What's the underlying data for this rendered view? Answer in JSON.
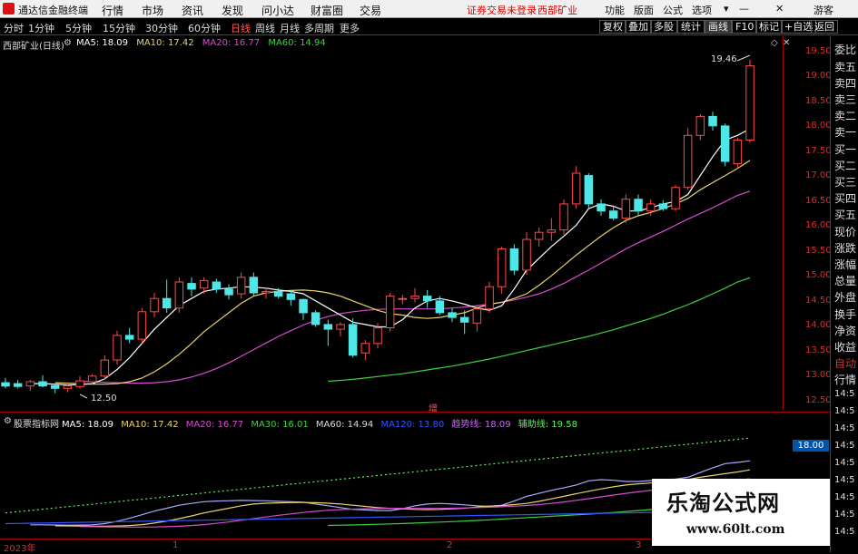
{
  "app": {
    "title": "通达信金融终端"
  },
  "menu": [
    "行情",
    "市场",
    "资讯",
    "发现",
    "问小达",
    "财富圈",
    "交易"
  ],
  "status": {
    "login": "证券交易未登录",
    "stock": "西部矿业"
  },
  "right_menu": [
    "功能",
    "版面",
    "公式",
    "选项",
    "游客"
  ],
  "periods": [
    "分时",
    "1分钟",
    "5分钟",
    "15分钟",
    "30分钟",
    "60分钟",
    "日线",
    "周线",
    "月线",
    "多周期",
    "更多"
  ],
  "active_period": "日线",
  "tools": [
    "复权",
    "叠加",
    "多股",
    "统计",
    "画线",
    "F10",
    "标记",
    "+自选",
    "返回"
  ],
  "main": {
    "stock_label": "西部矿业(日线)",
    "ma": [
      {
        "label": "MA5: 18.09",
        "color": "#ffffff"
      },
      {
        "label": "MA10: 17.42",
        "color": "#e8d36a"
      },
      {
        "label": "MA20: 16.77",
        "color": "#d94cd0"
      },
      {
        "label": "MA60: 14.94",
        "color": "#3fcf3f"
      }
    ],
    "high_label": "19.46",
    "low_label": "12.50",
    "marker": "增"
  },
  "price_axis": [
    "19.50",
    "19.00",
    "18.50",
    "18.00",
    "17.50",
    "17.00",
    "16.50",
    "16.00",
    "15.50",
    "15.00",
    "14.50",
    "14.00",
    "13.50",
    "13.00",
    "12.50"
  ],
  "right_panel": [
    "委比",
    "卖五",
    "卖四",
    "卖三",
    "卖二",
    "卖一",
    "买一",
    "买二",
    "买三",
    "买四",
    "买五",
    "现价",
    "涨跌",
    "涨幅",
    "总量",
    "外盘",
    "换手",
    "净资",
    "收益",
    "自动",
    "行情",
    "14:5",
    "14:5",
    "14:5",
    "14:5",
    "14:5",
    "14:5",
    "14:5",
    "14:5",
    "14:5"
  ],
  "sub": {
    "name": "股票指标网",
    "legend": [
      {
        "label": "MA5: 18.09",
        "color": "#ffffff"
      },
      {
        "label": "MA10: 17.42",
        "color": "#e8d36a"
      },
      {
        "label": "MA20: 16.77",
        "color": "#d94cd0"
      },
      {
        "label": "MA30: 16.01",
        "color": "#3fcf3f"
      },
      {
        "label": "MA60: 14.94",
        "color": "#dddddd"
      },
      {
        "label": "MA120: 13.80",
        "color": "#3355ff"
      },
      {
        "label": "趋势线: 18.09",
        "color": "#cc66ff"
      },
      {
        "label": "辅助线: 19.58",
        "color": "#5ff05f"
      }
    ],
    "badge": "18.00"
  },
  "x_axis": [
    "2023年",
    "1",
    "2",
    "3"
  ],
  "watermark": {
    "line1": "乐淘公式网",
    "line2": "www.60lt.com"
  },
  "chart_data": {
    "type": "candlestick",
    "y_range": [
      12.3,
      19.7
    ],
    "candles": [
      [
        12.72,
        12.82,
        12.6,
        12.65
      ],
      [
        12.7,
        12.78,
        12.6,
        12.64
      ],
      [
        12.65,
        12.78,
        12.55,
        12.74
      ],
      [
        12.74,
        12.88,
        12.62,
        12.65
      ],
      [
        12.66,
        12.7,
        12.5,
        12.6
      ],
      [
        12.6,
        12.68,
        12.52,
        12.65
      ],
      [
        12.64,
        12.86,
        12.6,
        12.76
      ],
      [
        12.74,
        12.9,
        12.68,
        12.86
      ],
      [
        12.86,
        13.3,
        12.8,
        13.2
      ],
      [
        13.2,
        13.82,
        13.1,
        13.72
      ],
      [
        13.72,
        13.88,
        13.55,
        13.64
      ],
      [
        13.64,
        14.3,
        13.55,
        14.22
      ],
      [
        14.22,
        14.62,
        14.1,
        14.5
      ],
      [
        14.5,
        14.9,
        14.2,
        14.3
      ],
      [
        14.3,
        14.95,
        14.2,
        14.85
      ],
      [
        14.82,
        14.95,
        14.55,
        14.7
      ],
      [
        14.72,
        14.95,
        14.6,
        14.88
      ],
      [
        14.85,
        14.92,
        14.62,
        14.7
      ],
      [
        14.7,
        14.8,
        14.48,
        14.58
      ],
      [
        14.6,
        15.05,
        14.5,
        14.95
      ],
      [
        14.95,
        15.05,
        14.55,
        14.62
      ],
      [
        14.62,
        14.72,
        14.5,
        14.65
      ],
      [
        14.65,
        14.72,
        14.5,
        14.55
      ],
      [
        14.6,
        14.68,
        14.35,
        14.48
      ],
      [
        14.48,
        14.5,
        14.05,
        14.2
      ],
      [
        14.2,
        14.25,
        13.9,
        13.95
      ],
      [
        13.95,
        14.05,
        13.5,
        13.85
      ],
      [
        13.85,
        14.0,
        13.7,
        13.95
      ],
      [
        13.95,
        14.08,
        13.25,
        13.3
      ],
      [
        13.35,
        13.62,
        13.2,
        13.55
      ],
      [
        13.55,
        13.98,
        13.45,
        13.88
      ],
      [
        13.88,
        14.62,
        13.8,
        14.55
      ],
      [
        14.5,
        14.58,
        14.38,
        14.5
      ],
      [
        14.5,
        14.72,
        14.42,
        14.55
      ],
      [
        14.55,
        14.68,
        14.3,
        14.45
      ],
      [
        14.45,
        14.55,
        14.15,
        14.2
      ],
      [
        14.2,
        14.3,
        14.0,
        14.1
      ],
      [
        14.1,
        14.25,
        13.75,
        14.0
      ],
      [
        13.98,
        14.35,
        13.8,
        14.28
      ],
      [
        14.28,
        14.85,
        14.2,
        14.75
      ],
      [
        14.75,
        15.6,
        14.6,
        15.55
      ],
      [
        15.55,
        15.65,
        15.0,
        15.1
      ],
      [
        15.1,
        15.9,
        15.0,
        15.75
      ],
      [
        15.75,
        16.0,
        15.6,
        15.9
      ],
      [
        15.9,
        16.2,
        15.72,
        15.95
      ],
      [
        15.95,
        16.6,
        15.85,
        16.5
      ],
      [
        16.5,
        17.3,
        16.4,
        17.15
      ],
      [
        17.1,
        17.15,
        16.4,
        16.5
      ],
      [
        16.5,
        16.6,
        16.25,
        16.35
      ],
      [
        16.35,
        16.45,
        16.15,
        16.2
      ],
      [
        16.2,
        16.7,
        16.1,
        16.6
      ],
      [
        16.6,
        16.7,
        16.25,
        16.35
      ],
      [
        16.35,
        16.6,
        16.25,
        16.5
      ],
      [
        16.5,
        16.58,
        16.35,
        16.4
      ],
      [
        16.4,
        16.9,
        16.35,
        16.85
      ],
      [
        16.85,
        18.1,
        16.8,
        17.95
      ],
      [
        17.95,
        18.4,
        17.85,
        18.35
      ],
      [
        18.35,
        18.45,
        18.05,
        18.15
      ],
      [
        18.15,
        18.2,
        17.3,
        17.4
      ],
      [
        17.35,
        17.9,
        17.25,
        17.85
      ],
      [
        17.85,
        19.55,
        17.8,
        19.42
      ]
    ],
    "ma5": [
      12.7,
      12.7,
      12.69,
      12.67,
      12.68,
      12.7,
      12.8,
      13.0,
      13.25,
      13.55,
      13.85,
      14.1,
      14.35,
      14.5,
      14.65,
      14.7,
      14.72,
      14.75,
      14.74,
      14.72,
      14.68,
      14.65,
      14.6,
      14.45,
      14.3,
      14.15,
      14.0,
      13.95,
      13.9,
      13.9,
      14.05,
      14.3,
      14.45,
      14.5,
      14.45,
      14.38,
      14.3,
      14.25,
      14.35,
      14.7,
      15.1,
      15.35,
      15.6,
      15.82,
      16.05,
      16.4,
      16.5,
      16.45,
      16.35,
      16.35,
      16.42,
      16.5,
      16.55,
      16.7,
      17.1,
      17.5,
      17.85,
      17.95,
      18.09
    ],
    "ma10": [
      12.72,
      12.71,
      12.7,
      12.69,
      12.69,
      12.7,
      12.74,
      12.82,
      12.95,
      13.12,
      13.32,
      13.55,
      13.8,
      14.0,
      14.2,
      14.4,
      14.55,
      14.62,
      14.65,
      14.67,
      14.68,
      14.66,
      14.62,
      14.55,
      14.45,
      14.35,
      14.25,
      14.18,
      14.15,
      14.1,
      14.08,
      14.1,
      14.15,
      14.2,
      14.3,
      14.38,
      14.42,
      14.5,
      14.6,
      14.78,
      14.98,
      15.2,
      15.42,
      15.62,
      15.82,
      16.0,
      16.15,
      16.25,
      16.32,
      16.4,
      16.5,
      16.62,
      16.8,
      16.95,
      17.1,
      17.25,
      17.42
    ],
    "ma20": [
      12.75,
      12.74,
      12.73,
      12.72,
      12.71,
      12.71,
      12.72,
      12.74,
      12.78,
      12.84,
      12.92,
      13.02,
      13.14,
      13.28,
      13.42,
      13.56,
      13.7,
      13.82,
      13.94,
      14.04,
      14.12,
      14.18,
      14.22,
      14.25,
      14.27,
      14.28,
      14.28,
      14.28,
      14.28,
      14.28,
      14.3,
      14.32,
      14.35,
      14.38,
      14.42,
      14.47,
      14.53,
      14.6,
      14.7,
      14.82,
      14.96,
      15.1,
      15.25,
      15.4,
      15.55,
      15.68,
      15.8,
      15.92,
      16.05,
      16.18,
      16.3,
      16.42,
      16.55,
      16.68,
      16.77
    ],
    "ma60": [
      12.75,
      12.77,
      12.79,
      12.82,
      12.85,
      12.88,
      12.91,
      12.95,
      12.99,
      13.03,
      13.07,
      13.12,
      13.17,
      13.22,
      13.28,
      13.34,
      13.4,
      13.46,
      13.52,
      13.58,
      13.64,
      13.7,
      13.77,
      13.84,
      13.92,
      14.0,
      14.08,
      14.17,
      14.27,
      14.37,
      14.48,
      14.6,
      14.72,
      14.85,
      14.94
    ]
  }
}
